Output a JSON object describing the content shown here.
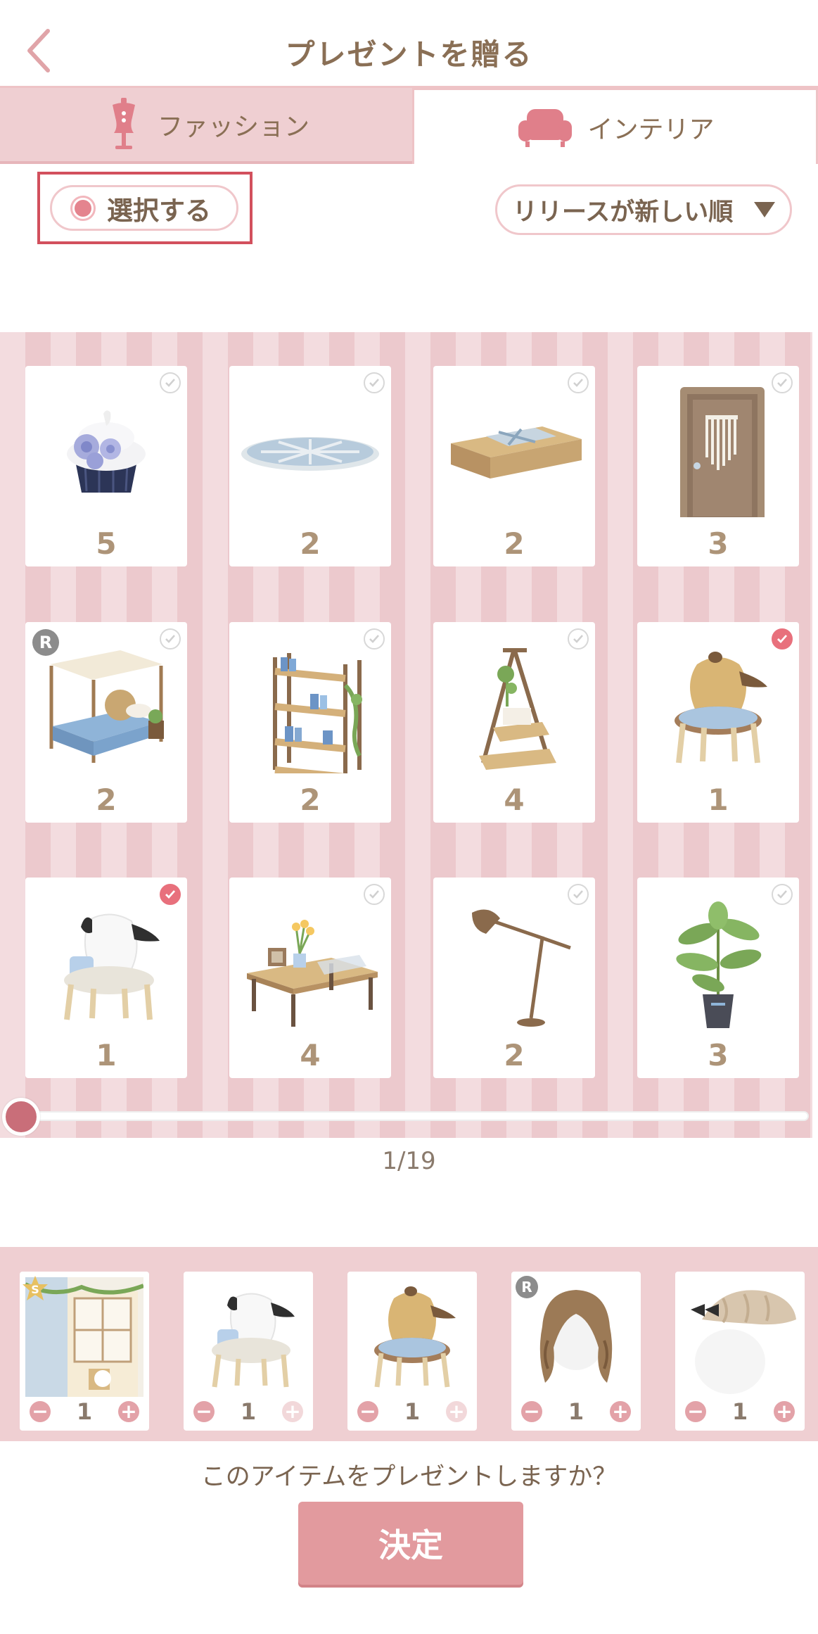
{
  "header": {
    "title": "プレゼントを贈る"
  },
  "tabs": [
    {
      "label": "ファッション",
      "icon": "mannequin-icon",
      "active": false
    },
    {
      "label": "インテリア",
      "icon": "sofa-icon",
      "active": true
    }
  ],
  "controls": {
    "select_label": "選択する",
    "sort_label": "リリースが新しい順"
  },
  "items": [
    {
      "name": "cupcake-item",
      "qty": "5",
      "checked": false,
      "badge": ""
    },
    {
      "name": "oval-rug-item",
      "qty": "2",
      "checked": false,
      "badge": ""
    },
    {
      "name": "low-table-item",
      "qty": "2",
      "checked": false,
      "badge": ""
    },
    {
      "name": "macrame-door-item",
      "qty": "3",
      "checked": false,
      "badge": ""
    },
    {
      "name": "canopy-bed-item",
      "qty": "2",
      "checked": false,
      "badge": "R"
    },
    {
      "name": "bookshelf-item",
      "qty": "2",
      "checked": false,
      "badge": ""
    },
    {
      "name": "plant-stand-item",
      "qty": "4",
      "checked": false,
      "badge": ""
    },
    {
      "name": "pompompurin-chair-item",
      "qty": "1",
      "checked": true,
      "badge": ""
    },
    {
      "name": "pochacco-chair-item",
      "qty": "1",
      "checked": true,
      "badge": ""
    },
    {
      "name": "coffee-table-item",
      "qty": "4",
      "checked": false,
      "badge": ""
    },
    {
      "name": "floor-lamp-item",
      "qty": "2",
      "checked": false,
      "badge": ""
    },
    {
      "name": "potted-plant-item",
      "qty": "3",
      "checked": false,
      "badge": ""
    }
  ],
  "pagination": {
    "text": "1/19",
    "current": 1,
    "total": 19
  },
  "selected": [
    {
      "name": "window-scene-item",
      "qty": "1",
      "badge": "S",
      "plus_enabled": true
    },
    {
      "name": "pochacco-chair-item",
      "qty": "1",
      "badge": "",
      "plus_enabled": false
    },
    {
      "name": "pompompurin-chair-item",
      "qty": "1",
      "badge": "",
      "plus_enabled": false
    },
    {
      "name": "wavy-hair-item",
      "qty": "1",
      "badge": "R",
      "plus_enabled": true
    },
    {
      "name": "knit-hat-item",
      "qty": "1",
      "badge": "",
      "plus_enabled": true
    }
  ],
  "confirm": {
    "question": "このアイテムをプレゼントしますか？",
    "button_label": "決定"
  },
  "colors": {
    "accent": "#e29a9e",
    "tab_bg": "#efcfd2",
    "text": "#7a6450",
    "check_active": "#e8707c"
  }
}
